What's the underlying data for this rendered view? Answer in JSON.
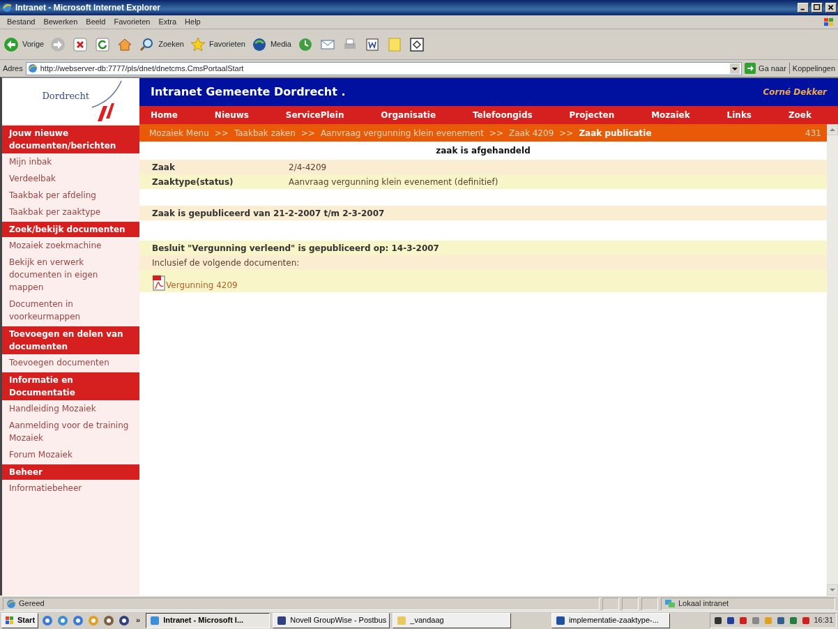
{
  "window": {
    "title": "Intranet - Microsoft Internet Explorer"
  },
  "menu_bar": [
    "Bestand",
    "Bewerken",
    "Beeld",
    "Favorieten",
    "Extra",
    "Help"
  ],
  "toolbar": {
    "back": "Vorige",
    "search": "Zoeken",
    "favorites": "Favorieten",
    "media": "Media"
  },
  "address_bar": {
    "label": "Adres",
    "url": "http://webserver-db:7777/pls/dnet/dnetcms.CmsPortaalStart",
    "go": "Ga naar",
    "links": "Koppelingen"
  },
  "site": {
    "logo": "Dordrecht",
    "title": "Intranet Gemeente Dordrecht .",
    "user": "Corné Dekker",
    "nav": [
      "Home",
      "Nieuws",
      "ServicePlein",
      "Organisatie",
      "Telefoongids",
      "Projecten",
      "Mozaiek",
      "Links",
      "Zoek"
    ]
  },
  "sidebar": [
    {
      "title": "Jouw nieuwe documenten/berichten",
      "items": [
        "Mijn inbak",
        "Verdeelbak",
        "Taakbak per afdeling",
        "Taakbak per zaaktype"
      ]
    },
    {
      "title": "Zoek/bekijk documenten",
      "items": [
        "Mozaiek zoekmachine",
        "Bekijk en verwerk documenten in eigen mappen",
        "Documenten in voorkeurmappen"
      ]
    },
    {
      "title": "Toevoegen en delen van documenten",
      "items": [
        "Toevoegen documenten"
      ]
    },
    {
      "title": "Informatie en Documentatie",
      "items": [
        "Handleiding Mozaiek",
        "Aanmelding voor de training Mozaiek",
        "Forum Mozaiek"
      ]
    },
    {
      "title": "Beheer",
      "items": [
        "Informatiebeheer"
      ]
    }
  ],
  "breadcrumb": {
    "items": [
      {
        "label": "Mozaiek Menu",
        "kind": "link"
      },
      {
        "label": ">>",
        "kind": "separator"
      },
      {
        "label": "Taakbak zaken",
        "kind": "link"
      },
      {
        "label": ">>",
        "kind": "separator"
      },
      {
        "label": "Aanvraag vergunning klein evenement",
        "kind": "link"
      },
      {
        "label": ">>",
        "kind": "separator"
      },
      {
        "label": "Zaak 4209",
        "kind": "link"
      },
      {
        "label": ">>",
        "kind": "separator"
      },
      {
        "label": "Zaak publicatie",
        "kind": "current"
      }
    ],
    "count": "431"
  },
  "case": {
    "status": "zaak is afgehandeld",
    "fields": [
      {
        "label": "Zaak",
        "value": "2/4-4209"
      },
      {
        "label": "Zaaktype(status)",
        "value": "Aanvraag vergunning klein evenement (definitief)"
      }
    ],
    "publication": "Zaak is gepubliceerd van 21-2-2007 t/m 2-3-2007",
    "decision": "Besluit \"Vergunning verleend\" is gepubliceerd op: 14-3-2007",
    "includes": "Inclusief de volgende documenten:",
    "documents": [
      "Vergunning 4209"
    ]
  },
  "status_bar": {
    "text": "Gereed",
    "zone": "Lokaal intranet"
  },
  "taskbar": {
    "start": "Start",
    "more": "»",
    "tasks": [
      {
        "label": "Intranet - Microsoft I...",
        "selected": true
      },
      {
        "label": "Novell GroupWise - Postbus",
        "selected": false
      },
      {
        "label": "_vandaag",
        "selected": false
      },
      {
        "label": "implementatie-zaaktype-...",
        "selected": false
      }
    ],
    "clock": "16:31"
  }
}
